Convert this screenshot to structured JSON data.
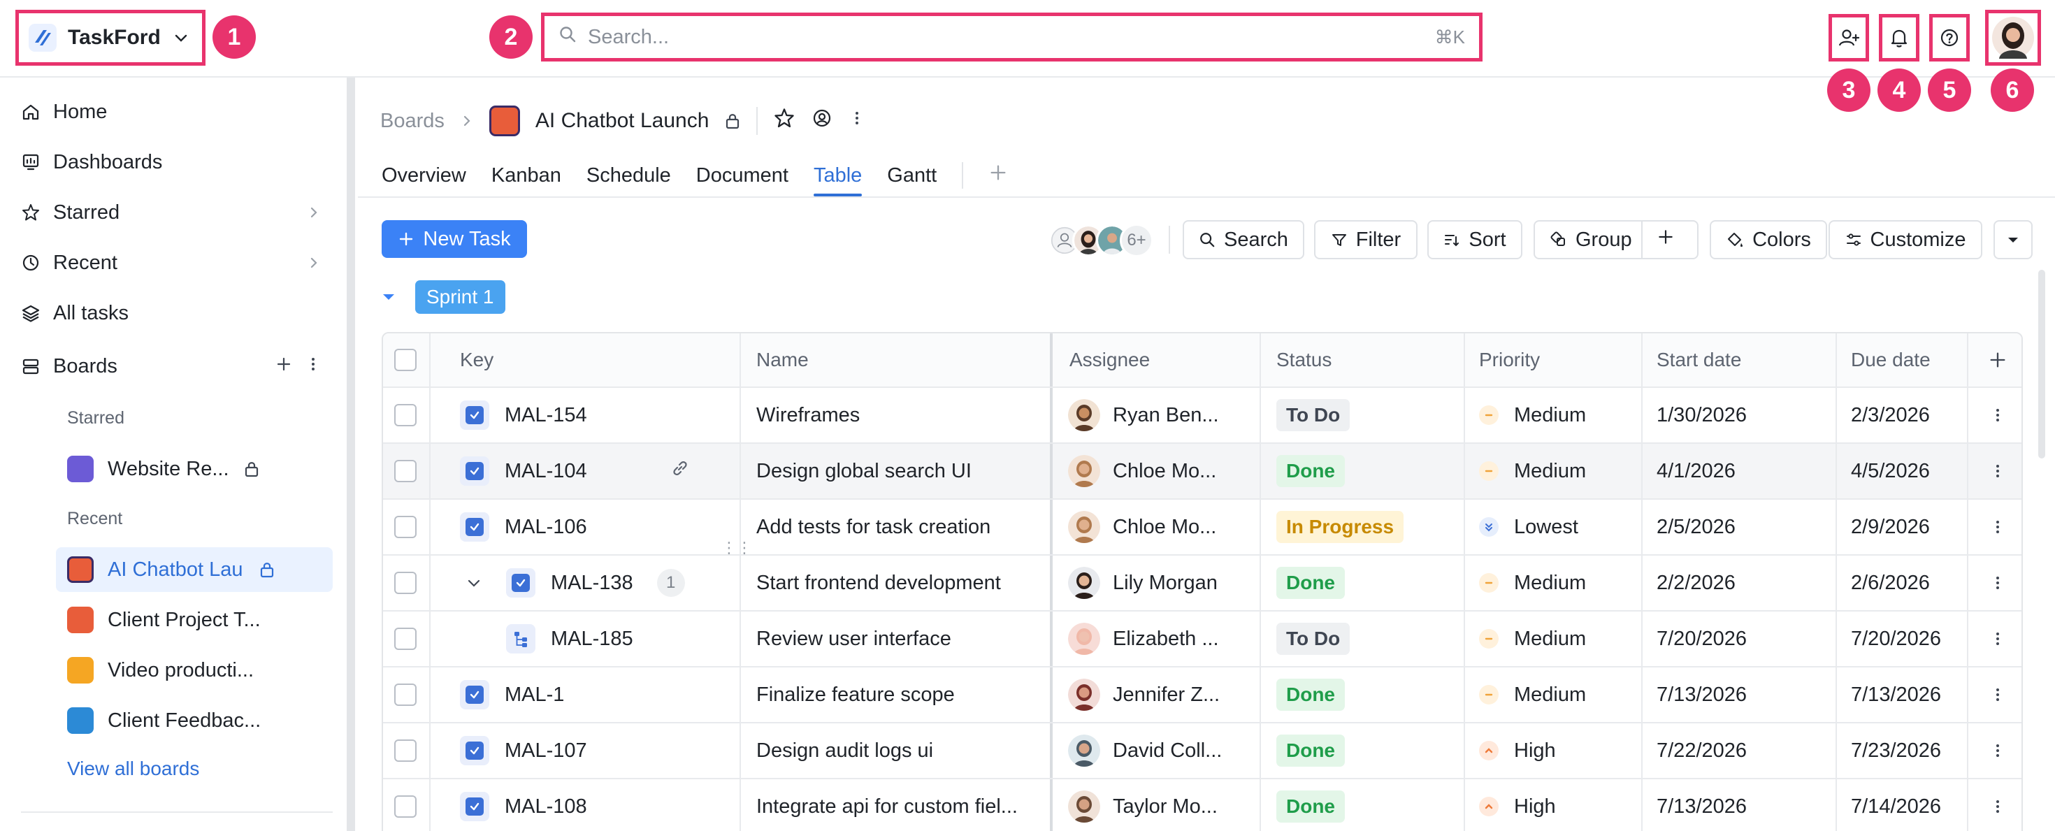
{
  "app": {
    "name": "TaskFord",
    "badges": [
      "1",
      "2",
      "3",
      "4",
      "5",
      "6"
    ]
  },
  "search": {
    "placeholder": "Search...",
    "shortcut": "⌘K"
  },
  "sidebar": {
    "nav": [
      {
        "label": "Home",
        "icon": "home-icon"
      },
      {
        "label": "Dashboards",
        "icon": "dashboard-icon"
      },
      {
        "label": "Starred",
        "icon": "star-icon"
      },
      {
        "label": "Recent",
        "icon": "clock-icon"
      },
      {
        "label": "All tasks",
        "icon": "layers-icon"
      }
    ],
    "boards_label": "Boards",
    "starred_label": "Starred",
    "recent_label": "Recent",
    "starred_boards": [
      {
        "label": "Website Re...",
        "color": "#6c5bd6"
      }
    ],
    "recent_boards": [
      {
        "label": "AI Chatbot Lau",
        "color": "#e85d3a"
      },
      {
        "label": "Client Project T...",
        "color": "#e85d3a"
      },
      {
        "label": "Video producti...",
        "color": "#f5a623"
      },
      {
        "label": "Client Feedbac...",
        "color": "#2c8ad6"
      }
    ],
    "view_all": "View all boards"
  },
  "breadcrumb": {
    "root": "Boards",
    "title": "AI Chatbot Launch"
  },
  "tabs": [
    "Overview",
    "Kanban",
    "Schedule",
    "Document",
    "Table",
    "Gantt"
  ],
  "active_tab": "Table",
  "toolbar": {
    "new_task": "New Task",
    "members_more": "6+",
    "search": "Search",
    "filter": "Filter",
    "sort": "Sort",
    "group": "Group",
    "colors": "Colors",
    "customize": "Customize"
  },
  "group": {
    "name": "Sprint 1"
  },
  "table": {
    "columns": [
      "Key",
      "Name",
      "Assignee",
      "Status",
      "Priority",
      "Start date",
      "Due date"
    ],
    "rows": [
      {
        "key": "MAL-154",
        "name": "Wireframes",
        "assignee": "Ryan Ben...",
        "status": "To Do",
        "priority": "Medium",
        "start": "1/30/2026",
        "due": "2/3/2026"
      },
      {
        "key": "MAL-104",
        "name": "Design global search UI",
        "assignee": "Chloe Mo...",
        "status": "Done",
        "priority": "Medium",
        "start": "4/1/2026",
        "due": "4/5/2026"
      },
      {
        "key": "MAL-106",
        "name": "Add tests for task creation",
        "assignee": "Chloe Mo...",
        "status": "In Progress",
        "priority": "Lowest",
        "start": "2/5/2026",
        "due": "2/9/2026"
      },
      {
        "key": "MAL-138",
        "name": "Start frontend development",
        "assignee": "Lily Morgan",
        "status": "Done",
        "priority": "Medium",
        "start": "2/2/2026",
        "due": "2/6/2026",
        "subtasks": "1"
      },
      {
        "key": "MAL-185",
        "name": "Review user interface",
        "assignee": "Elizabeth ...",
        "status": "To Do",
        "priority": "Medium",
        "start": "7/20/2026",
        "due": "7/20/2026"
      },
      {
        "key": "MAL-1",
        "name": "Finalize feature scope",
        "assignee": "Jennifer Z...",
        "status": "Done",
        "priority": "Medium",
        "start": "7/13/2026",
        "due": "7/13/2026"
      },
      {
        "key": "MAL-107",
        "name": "Design audit logs ui",
        "assignee": "David Coll...",
        "status": "Done",
        "priority": "High",
        "start": "7/22/2026",
        "due": "7/23/2026"
      },
      {
        "key": "MAL-108",
        "name": "Integrate api for custom fiel...",
        "assignee": "Taylor Mo...",
        "status": "Done",
        "priority": "High",
        "start": "7/13/2026",
        "due": "7/14/2026"
      }
    ]
  },
  "colors": {
    "accent": "#3b82f6",
    "highlight": "#e8336d",
    "done": "#1f9d4a",
    "in_progress": "#c78a00"
  }
}
